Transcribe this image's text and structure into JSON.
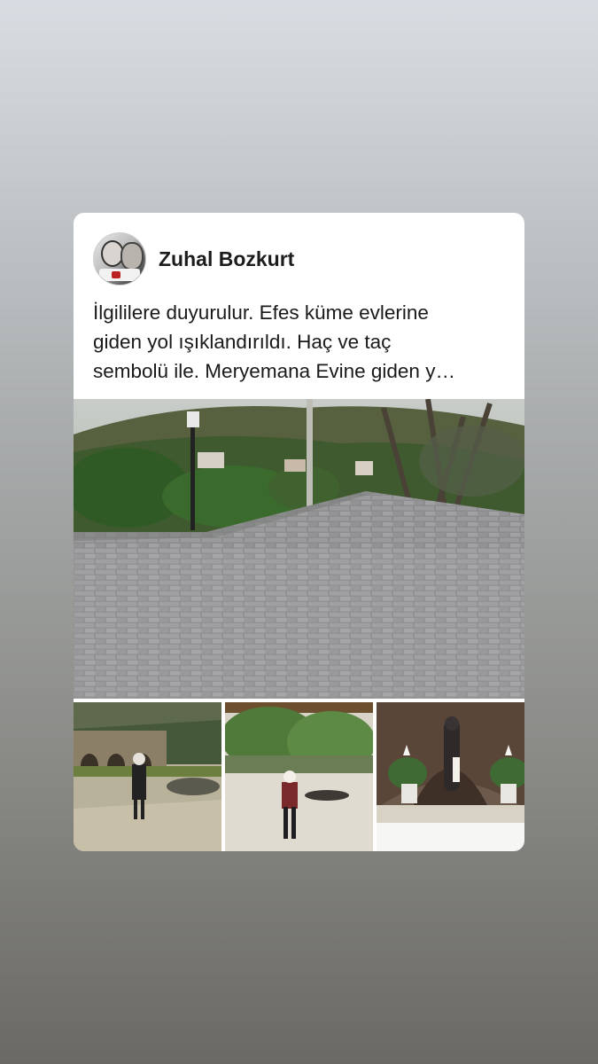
{
  "post": {
    "author": "Zuhal Bozkurt",
    "text_lines": [
      "İlgililere duyurulur. Efes küme evlerine",
      "giden yol ışıklandırıldı. Haç ve taç",
      "sembolü ile. Meryemana Evine giden y…"
    ]
  },
  "icons": {
    "avatar": "profile-avatar-photo"
  },
  "colors": {
    "card_background": "#ffffff",
    "text": "#1a1a1a"
  }
}
